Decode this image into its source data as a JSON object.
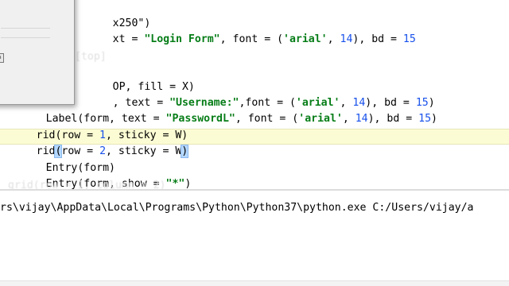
{
  "editor": {
    "line1_tail": "x250\")",
    "line2_lead": "xt = ",
    "line2_str": "\"Login Form\"",
    "line2_mid": ", font = (",
    "line2_font": "'arial'",
    "line2_sep": ", ",
    "line2_size": "14",
    "line2_bd": "), bd = ",
    "line2_bdval": "15",
    "line3_lead": "OP, fill = X)",
    "line4_lead": ", text = ",
    "line4_str": "\"Username:\"",
    "line4_mid": ",font = (",
    "line4_font": "'arial'",
    "line4_sep": ", ",
    "line4_size": "14",
    "line4_bd": "), bd = ",
    "line4_bdval": "15",
    "line4_end": ")",
    "line5_lead": "Label(form, text = ",
    "line5_str": "\"PasswordL\"",
    "line5_mid": ", font = (",
    "line5_font": "'arial'",
    "line5_sep": ", ",
    "line5_size": "14",
    "line5_bd": "), bd = ",
    "line5_bdval": "15",
    "line5_end": ")",
    "line6_lead": "rid(row = ",
    "line6_row": "1",
    "line6_end": ", sticky = W)",
    "line7_lead": "rid",
    "line7_open": "(",
    "line7_mid": "row = ",
    "line7_row": "2",
    "line7_tail": ", sticky = W",
    "line7_close": ")",
    "line8": "Entry(form)",
    "line9_lead": "Entry(form, show = ",
    "line9_str": "\"*\"",
    "line9_end": ")"
  },
  "console": {
    "run_command": "rs\\vijay\\AppData\\Local\\Programs\\Python\\Python37\\python.exe C:/Users/vijay/a"
  },
  "tk_window": {
    "button_label": "in"
  }
}
